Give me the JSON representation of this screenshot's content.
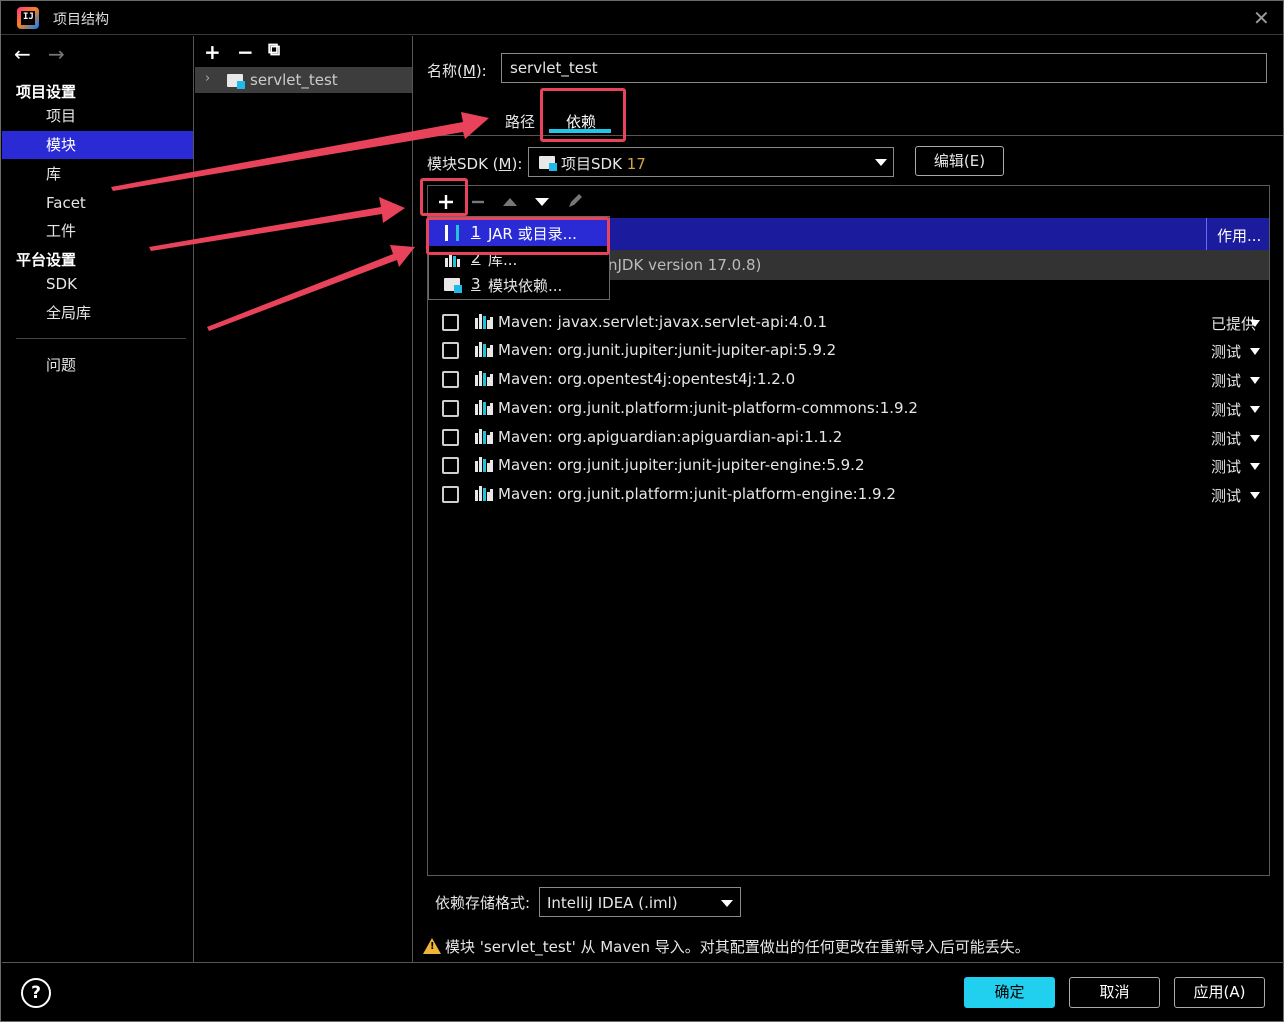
{
  "window": {
    "title": "项目结构"
  },
  "nav": {
    "back": "←",
    "forward": "→",
    "project_settings_header": "项目设置",
    "project_items": [
      "项目",
      "模块",
      "库",
      "Facet",
      "工件"
    ],
    "platform_settings_header": "平台设置",
    "platform_items": [
      "SDK",
      "全局库"
    ],
    "problems": "问题",
    "selected": "模块"
  },
  "module_tree": {
    "toolbar": {
      "add": "+",
      "remove": "−",
      "copy": "⧉"
    },
    "modules": [
      "servlet_test"
    ]
  },
  "module": {
    "name_label_prefix": "名称(",
    "name_label_mnemonic": "M",
    "name_label_suffix": "):",
    "name_value": "servlet_test",
    "tabs": [
      "路径",
      "依赖"
    ],
    "active_tab": "依赖",
    "sdk_label_prefix": "模块SDK (",
    "sdk_label_mnemonic": "M",
    "sdk_label_suffix": "):",
    "sdk_name": "项目SDK",
    "sdk_version": "17",
    "edit_button": "编辑(E)"
  },
  "dependencies": {
    "scope_header": "作用...",
    "sdk_row_text": "nJDK version 17.0.8)",
    "items": [
      {
        "name": "Maven: javax.servlet:javax.servlet-api:4.0.1",
        "scope": "已提供",
        "checked": false
      },
      {
        "name": "Maven: org.junit.jupiter:junit-jupiter-api:5.9.2",
        "scope": "测试",
        "checked": false
      },
      {
        "name": "Maven: org.opentest4j:opentest4j:1.2.0",
        "scope": "测试",
        "checked": false
      },
      {
        "name": "Maven: org.junit.platform:junit-platform-commons:1.9.2",
        "scope": "测试",
        "checked": false
      },
      {
        "name": "Maven: org.apiguardian:apiguardian-api:1.1.2",
        "scope": "测试",
        "checked": false
      },
      {
        "name": "Maven: org.junit.jupiter:junit-jupiter-engine:5.9.2",
        "scope": "测试",
        "checked": false
      },
      {
        "name": "Maven: org.junit.platform:junit-platform-engine:1.9.2",
        "scope": "测试",
        "checked": false
      }
    ]
  },
  "add_popup": {
    "items": [
      {
        "num": "1",
        "label": "JAR 或目录..."
      },
      {
        "num": "2",
        "label": "库..."
      },
      {
        "num": "3",
        "label": "模块依赖..."
      }
    ],
    "selected_index": 0
  },
  "storage_format": {
    "label": "依赖存储格式:",
    "value": "IntelliJ IDEA (.iml)"
  },
  "warning": "模块 'servlet_test' 从 Maven 导入。对其配置做出的任何更改在重新导入后可能丢失。",
  "buttons": {
    "help": "?",
    "ok": "确定",
    "cancel": "取消",
    "apply": "应用(A)"
  },
  "colors": {
    "selection": "#2b2bd6",
    "accent": "#21d0ee",
    "annotation": "#e8435b",
    "sdk_version": "#d6a447"
  }
}
